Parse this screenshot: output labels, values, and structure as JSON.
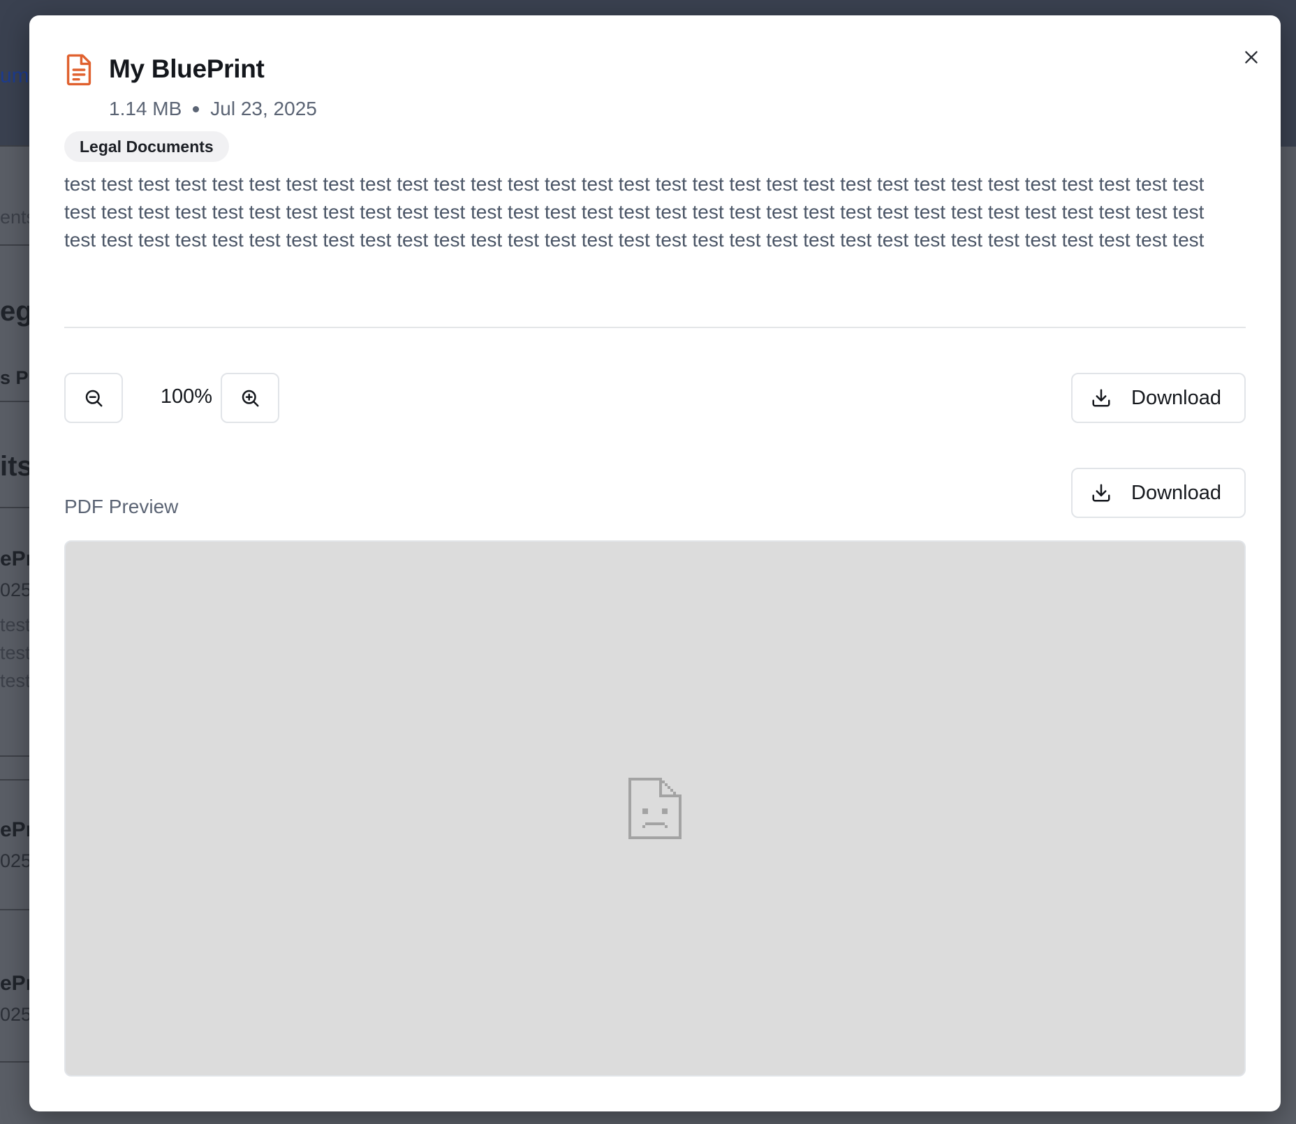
{
  "background": {
    "link_fragment": "um",
    "side_label_1": "ents",
    "heading_fragment_1": "eg",
    "side_label_2": "s Pl",
    "heading_fragment_2": "its",
    "item_1": {
      "title": "ePr",
      "date": "025",
      "lines": [
        "test",
        "test",
        "test"
      ]
    },
    "item_2": {
      "title": "ePr",
      "date": "025"
    },
    "item_3": {
      "title": "ePr",
      "date": "025"
    }
  },
  "modal": {
    "title": "My BluePrint",
    "file_size": "1.14 MB",
    "date": "Jul 23, 2025",
    "tag": "Legal Documents",
    "description": "test test test test test test test test test test test test test test test test test test test test test test test test test test test test test test test test test test test test test test test test test test test test test test test test test test test test test test test test test test test test test test test test test test test test test test test test test test test test test test test test test test test test test test test test test test test test test",
    "zoom_level": "100%",
    "download_label_toolbar": "Download",
    "preview_label": "PDF Preview",
    "download_label_preview": "Download"
  },
  "icons": {
    "document": "file-text-icon",
    "close": "close-icon",
    "zoom_out": "zoom-out-icon",
    "zoom_in": "zoom-in-icon",
    "download": "download-icon",
    "broken_file": "broken-document-icon"
  },
  "colors": {
    "accent": "#e0612f",
    "preview_background": "#dcdcdc"
  }
}
